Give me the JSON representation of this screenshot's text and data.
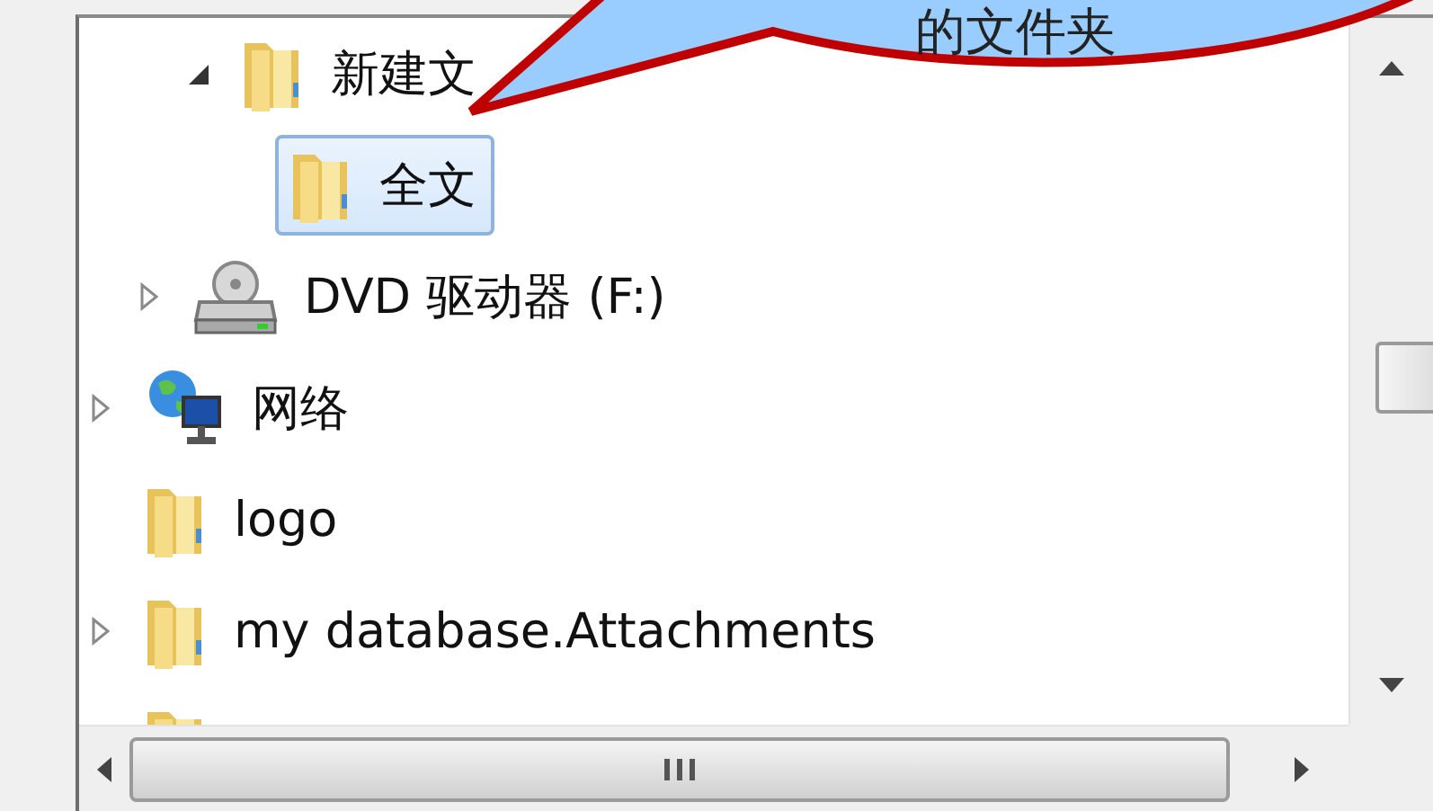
{
  "callout": {
    "text": "的文件夹"
  },
  "tree": {
    "items": [
      {
        "children": [
          {
            "children": [
              {
                "label": "新建文",
                "kind": "folder",
                "expanded": true,
                "selected": false,
                "children": [
                  {
                    "label": "全文",
                    "kind": "folder",
                    "selected": true
                  }
                ]
              }
            ]
          },
          {
            "label": "DVD 驱动器 (F:)",
            "kind": "dvd",
            "expanded": false,
            "selected": false
          }
        ]
      },
      {
        "label": "网络",
        "kind": "network",
        "expanded": false,
        "selected": false
      },
      {
        "label": "logo",
        "kind": "folder",
        "selected": false
      },
      {
        "label": "my database.Attachments",
        "kind": "folder",
        "expanded": false,
        "selected": false
      },
      {
        "kind": "folder"
      }
    ]
  }
}
